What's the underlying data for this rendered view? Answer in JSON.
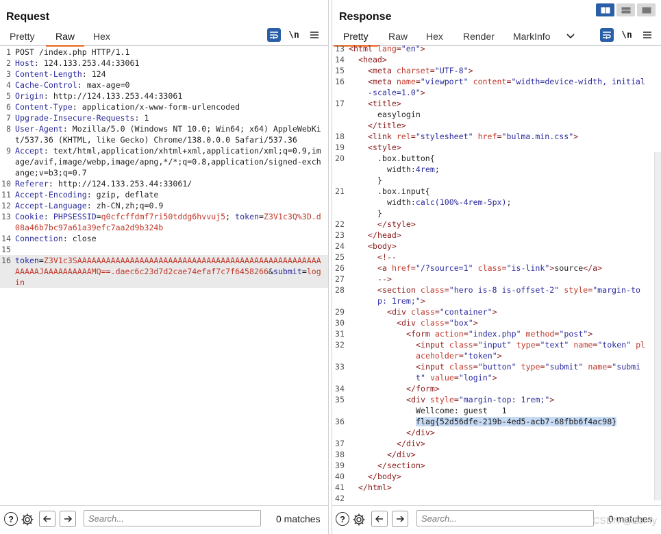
{
  "request": {
    "title": "Request",
    "tabs": [
      "Pretty",
      "Raw",
      "Hex"
    ],
    "active_tab": "Raw",
    "lines": [
      {
        "n": "1",
        "parts": [
          [
            "hv",
            "POST /index.php HTTP/1.1"
          ]
        ]
      },
      {
        "n": "2",
        "parts": [
          [
            "hk",
            "Host"
          ],
          [
            "hv",
            ": 124.133.253.44:33061"
          ]
        ]
      },
      {
        "n": "3",
        "parts": [
          [
            "hk",
            "Content-Length"
          ],
          [
            "hv",
            ": 124"
          ]
        ]
      },
      {
        "n": "4",
        "parts": [
          [
            "hk",
            "Cache-Control"
          ],
          [
            "hv",
            ": max-age=0"
          ]
        ]
      },
      {
        "n": "5",
        "parts": [
          [
            "hk",
            "Origin"
          ],
          [
            "hv",
            ": http://124.133.253.44:33061"
          ]
        ]
      },
      {
        "n": "6",
        "parts": [
          [
            "hk",
            "Content-Type"
          ],
          [
            "hv",
            ": application/x-www-form-urlencoded"
          ]
        ]
      },
      {
        "n": "7",
        "parts": [
          [
            "hk",
            "Upgrade-Insecure-Requests"
          ],
          [
            "hv",
            ": 1"
          ]
        ]
      },
      {
        "n": "8",
        "parts": [
          [
            "hk",
            "User-Agent"
          ],
          [
            "hv",
            ": Mozilla/5.0 (Windows NT 10.0; Win64; x64) AppleWebKit/537.36 (KHTML, like Gecko) Chrome/138.0.0.0 Safari/537.36"
          ]
        ]
      },
      {
        "n": "9",
        "parts": [
          [
            "hk",
            "Accept"
          ],
          [
            "hv",
            ": text/html,application/xhtml+xml,application/xml;q=0.9,image/avif,image/webp,image/apng,*/*;q=0.8,application/signed-exchange;v=b3;q=0.7"
          ]
        ]
      },
      {
        "n": "10",
        "parts": [
          [
            "hk",
            "Referer"
          ],
          [
            "hv",
            ": http://124.133.253.44:33061/"
          ]
        ]
      },
      {
        "n": "11",
        "parts": [
          [
            "hk",
            "Accept-Encoding"
          ],
          [
            "hv",
            ": gzip, deflate"
          ]
        ]
      },
      {
        "n": "12",
        "parts": [
          [
            "hk",
            "Accept-Language"
          ],
          [
            "hv",
            ": zh-CN,zh;q=0.9"
          ]
        ]
      },
      {
        "n": "13",
        "parts": [
          [
            "hk",
            "Cookie"
          ],
          [
            "hv",
            ": "
          ],
          [
            "ck",
            "PHPSESSID"
          ],
          [
            "hv",
            "="
          ],
          [
            "param",
            "q0cfcffdmf7ri50tddg6hvvuj5"
          ],
          [
            "hv",
            "; "
          ],
          [
            "ck",
            "token"
          ],
          [
            "hv",
            "="
          ],
          [
            "param",
            "Z3V1c3Q%3D.d08a46b7bc97a61a39efc7aa2d9b324b"
          ]
        ]
      },
      {
        "n": "14",
        "parts": [
          [
            "hk",
            "Connection"
          ],
          [
            "hv",
            ": close"
          ]
        ]
      },
      {
        "n": "15",
        "parts": [
          [
            "hv",
            ""
          ]
        ]
      },
      {
        "n": "16",
        "parts": [
          [
            "ck",
            "token"
          ],
          [
            "hv",
            "="
          ],
          [
            "param",
            "Z3V1c3SAAAAAAAAAAAAAAAAAAAAAAAAAAAAAAAAAAAAAAAAAAAAAAAAAAAAAAAAJAAAAAAAAAAMQ==.daec6c23d7d2cae74efaf7c7f6458266"
          ],
          [
            "hv",
            "&"
          ],
          [
            "ck",
            "submit"
          ],
          [
            "hv",
            "="
          ],
          [
            "param",
            "login"
          ]
        ],
        "highlight": true
      }
    ],
    "search_placeholder": "Search...",
    "matches": "0 matches"
  },
  "response": {
    "title": "Response",
    "tabs": [
      "Pretty",
      "Raw",
      "Hex",
      "Render",
      "MarkInfo"
    ],
    "active_tab": "Pretty",
    "lines": [
      {
        "n": "13",
        "ind": 0,
        "parts": [
          [
            "tag",
            "<html "
          ],
          [
            "attr",
            "lang"
          ],
          [
            "tag",
            "="
          ],
          [
            "aval",
            "\"en\""
          ],
          [
            "tag",
            ">"
          ]
        ]
      },
      {
        "n": "14",
        "ind": 1,
        "parts": [
          [
            "tag",
            "<head>"
          ]
        ]
      },
      {
        "n": "15",
        "ind": 2,
        "parts": [
          [
            "tag",
            "<meta "
          ],
          [
            "attr",
            "charset"
          ],
          [
            "tag",
            "="
          ],
          [
            "aval",
            "\"UTF-8\""
          ],
          [
            "tag",
            ">"
          ]
        ]
      },
      {
        "n": "16",
        "ind": 2,
        "parts": [
          [
            "tag",
            "<meta "
          ],
          [
            "attr",
            "name"
          ],
          [
            "tag",
            "="
          ],
          [
            "aval",
            "\"viewport\""
          ],
          [
            "tag",
            " "
          ],
          [
            "attr",
            "content"
          ],
          [
            "tag",
            "="
          ],
          [
            "aval",
            "\"width=device-width, initial-scale=1.0\""
          ],
          [
            "tag",
            ">"
          ]
        ]
      },
      {
        "n": "17",
        "ind": 2,
        "parts": [
          [
            "tag",
            "<title>"
          ]
        ]
      },
      {
        "n": "",
        "ind": 3,
        "parts": [
          [
            "txt",
            "easylogin"
          ]
        ]
      },
      {
        "n": "",
        "ind": 2,
        "parts": [
          [
            "tag",
            "</title>"
          ]
        ]
      },
      {
        "n": "18",
        "ind": 2,
        "parts": [
          [
            "tag",
            "<link "
          ],
          [
            "attr",
            "rel"
          ],
          [
            "tag",
            "="
          ],
          [
            "aval",
            "\"stylesheet\""
          ],
          [
            "tag",
            " "
          ],
          [
            "attr",
            "href"
          ],
          [
            "tag",
            "="
          ],
          [
            "aval",
            "\"bulma.min.css\""
          ],
          [
            "tag",
            ">"
          ]
        ]
      },
      {
        "n": "19",
        "ind": 2,
        "parts": [
          [
            "tag",
            "<style>"
          ]
        ]
      },
      {
        "n": "20",
        "ind": 3,
        "parts": [
          [
            "txt",
            ".box.button{"
          ]
        ]
      },
      {
        "n": "",
        "ind": 4,
        "parts": [
          [
            "txt",
            "width:"
          ],
          [
            "cssv",
            "4rem"
          ],
          [
            "txt",
            ";"
          ]
        ]
      },
      {
        "n": "",
        "ind": 3,
        "parts": [
          [
            "txt",
            "}"
          ]
        ]
      },
      {
        "n": "21",
        "ind": 3,
        "parts": [
          [
            "txt",
            ".box.input{"
          ]
        ]
      },
      {
        "n": "",
        "ind": 4,
        "parts": [
          [
            "txt",
            "width:"
          ],
          [
            "cssv",
            "calc(100%-4rem-5px)"
          ],
          [
            "txt",
            ";"
          ]
        ]
      },
      {
        "n": "",
        "ind": 3,
        "parts": [
          [
            "txt",
            "}"
          ]
        ]
      },
      {
        "n": "22",
        "ind": 3,
        "parts": [
          [
            "tag",
            "</style>"
          ]
        ]
      },
      {
        "n": "23",
        "ind": 2,
        "parts": [
          [
            "tag",
            "</head>"
          ]
        ]
      },
      {
        "n": "24",
        "ind": 2,
        "parts": [
          [
            "tag",
            "<body>"
          ]
        ]
      },
      {
        "n": "25",
        "ind": 3,
        "parts": [
          [
            "tag",
            "<!--"
          ]
        ]
      },
      {
        "n": "26",
        "ind": 3,
        "parts": [
          [
            "tag",
            "<a "
          ],
          [
            "attr",
            "href"
          ],
          [
            "tag",
            "="
          ],
          [
            "aval",
            "\"/?source=1\""
          ],
          [
            "tag",
            " "
          ],
          [
            "attr",
            "class"
          ],
          [
            "tag",
            "="
          ],
          [
            "aval",
            "\"is-link\""
          ],
          [
            "tag",
            ">"
          ],
          [
            "txt",
            "source"
          ],
          [
            "tag",
            "</a>"
          ]
        ]
      },
      {
        "n": "27",
        "ind": 3,
        "parts": [
          [
            "tag",
            "-->"
          ]
        ]
      },
      {
        "n": "28",
        "ind": 3,
        "parts": [
          [
            "tag",
            "<section "
          ],
          [
            "attr",
            "class"
          ],
          [
            "tag",
            "="
          ],
          [
            "aval",
            "\"hero is-8 is-offset-2\""
          ],
          [
            "tag",
            " "
          ],
          [
            "attr",
            "style"
          ],
          [
            "tag",
            "="
          ],
          [
            "aval",
            "\"margin-top: 1rem;\""
          ],
          [
            "tag",
            ">"
          ]
        ]
      },
      {
        "n": "29",
        "ind": 4,
        "parts": [
          [
            "tag",
            "<div "
          ],
          [
            "attr",
            "class"
          ],
          [
            "tag",
            "="
          ],
          [
            "aval",
            "\"container\""
          ],
          [
            "tag",
            ">"
          ]
        ]
      },
      {
        "n": "30",
        "ind": 5,
        "parts": [
          [
            "tag",
            "<div "
          ],
          [
            "attr",
            "class"
          ],
          [
            "tag",
            "="
          ],
          [
            "aval",
            "\"box\""
          ],
          [
            "tag",
            ">"
          ]
        ]
      },
      {
        "n": "31",
        "ind": 6,
        "parts": [
          [
            "tag",
            "<form "
          ],
          [
            "attr",
            "action"
          ],
          [
            "tag",
            "="
          ],
          [
            "aval",
            "\"index.php\""
          ],
          [
            "tag",
            " "
          ],
          [
            "attr",
            "method"
          ],
          [
            "tag",
            "="
          ],
          [
            "aval",
            "\"post\""
          ],
          [
            "tag",
            ">"
          ]
        ]
      },
      {
        "n": "32",
        "ind": 7,
        "parts": [
          [
            "tag",
            "<input "
          ],
          [
            "attr",
            "class"
          ],
          [
            "tag",
            "="
          ],
          [
            "aval",
            "\"input\""
          ],
          [
            "tag",
            " "
          ],
          [
            "attr",
            "type"
          ],
          [
            "tag",
            "="
          ],
          [
            "aval",
            "\"text\""
          ],
          [
            "tag",
            " "
          ],
          [
            "attr",
            "name"
          ],
          [
            "tag",
            "="
          ],
          [
            "aval",
            "\"token\""
          ],
          [
            "tag",
            " "
          ],
          [
            "attr",
            "placeholder"
          ],
          [
            "tag",
            "="
          ],
          [
            "aval",
            "\"token\""
          ],
          [
            "tag",
            ">"
          ]
        ]
      },
      {
        "n": "33",
        "ind": 7,
        "parts": [
          [
            "tag",
            "<input "
          ],
          [
            "attr",
            "class"
          ],
          [
            "tag",
            "="
          ],
          [
            "aval",
            "\"button\""
          ],
          [
            "tag",
            " "
          ],
          [
            "attr",
            "type"
          ],
          [
            "tag",
            "="
          ],
          [
            "aval",
            "\"submit\""
          ],
          [
            "tag",
            " "
          ],
          [
            "attr",
            "name"
          ],
          [
            "tag",
            "="
          ],
          [
            "aval",
            "\"submit\""
          ],
          [
            "tag",
            " "
          ],
          [
            "attr",
            "value"
          ],
          [
            "tag",
            "="
          ],
          [
            "aval",
            "\"login\""
          ],
          [
            "tag",
            ">"
          ]
        ]
      },
      {
        "n": "34",
        "ind": 6,
        "parts": [
          [
            "tag",
            "</form>"
          ]
        ]
      },
      {
        "n": "35",
        "ind": 6,
        "parts": [
          [
            "tag",
            "<div "
          ],
          [
            "attr",
            "style"
          ],
          [
            "tag",
            "="
          ],
          [
            "aval",
            "\"margin-top: 1rem;\""
          ],
          [
            "tag",
            ">"
          ]
        ]
      },
      {
        "n": "",
        "ind": 7,
        "parts": [
          [
            "txt",
            "Wellcome: guest   1"
          ]
        ]
      },
      {
        "n": "36",
        "ind": 7,
        "parts": [
          [
            "sel",
            "flag{52d56dfe-219b-4ed5-acb7-68fbb6f4ac98}"
          ]
        ]
      },
      {
        "n": "",
        "ind": 6,
        "parts": [
          [
            "tag",
            "</div>"
          ]
        ]
      },
      {
        "n": "37",
        "ind": 5,
        "parts": [
          [
            "tag",
            "</div>"
          ]
        ]
      },
      {
        "n": "38",
        "ind": 4,
        "parts": [
          [
            "tag",
            "</div>"
          ]
        ]
      },
      {
        "n": "39",
        "ind": 3,
        "parts": [
          [
            "tag",
            "</section>"
          ]
        ]
      },
      {
        "n": "40",
        "ind": 2,
        "parts": [
          [
            "tag",
            "</body>"
          ]
        ]
      },
      {
        "n": "41",
        "ind": 1,
        "parts": [
          [
            "tag",
            "</html>"
          ]
        ]
      },
      {
        "n": "42",
        "ind": 0,
        "parts": [
          [
            "txt",
            ""
          ]
        ]
      }
    ],
    "search_placeholder": "Search...",
    "matches": "0 matches"
  },
  "toolbar_icons": {
    "wrap": "wrap-lines-icon",
    "newline": "\\n",
    "menu": "hamburger-icon"
  },
  "chevron": "chevron-down-icon",
  "watermark": "CSDN @Z3r4y",
  "colors": {
    "accent": "#e8661a",
    "button_blue": "#2a5fa8"
  }
}
